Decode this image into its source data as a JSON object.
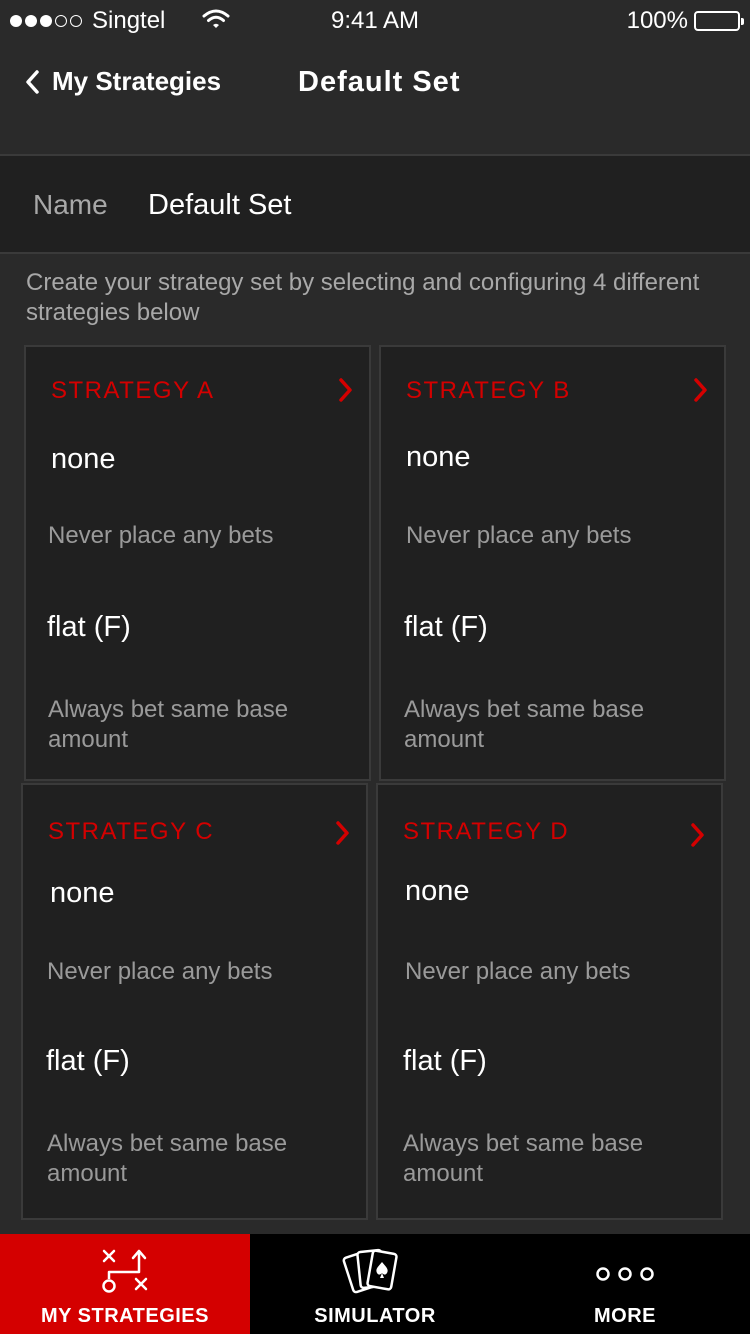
{
  "status_bar": {
    "carrier": "Singtel",
    "time": "9:41 AM",
    "battery": "100%",
    "signal_bars_filled": 3,
    "signal_bars_total": 5
  },
  "nav": {
    "back_label": "My Strategies",
    "title": "Default Set"
  },
  "name_row": {
    "label": "Name",
    "value": "Default Set"
  },
  "instructions": "Create your strategy set by selecting and configuring 4 different strategies below",
  "strategies": [
    {
      "title": "STRATEGY A",
      "bet_name": "none",
      "bet_desc": "Never place any bets",
      "sizing_name": "flat (F)",
      "sizing_desc": "Always bet same base amount"
    },
    {
      "title": "STRATEGY B",
      "bet_name": "none",
      "bet_desc": "Never place any bets",
      "sizing_name": "flat (F)",
      "sizing_desc": "Always bet same base amount"
    },
    {
      "title": "STRATEGY C",
      "bet_name": "none",
      "bet_desc": "Never place any bets",
      "sizing_name": "flat (F)",
      "sizing_desc": "Always bet same base amount"
    },
    {
      "title": "STRATEGY D",
      "bet_name": "none",
      "bet_desc": "Never place any bets",
      "sizing_name": "flat (F)",
      "sizing_desc": "Always bet same base amount"
    }
  ],
  "tabs": [
    {
      "label": "MY STRATEGIES",
      "icon": "strategy-play-icon",
      "active": true
    },
    {
      "label": "SIMULATOR",
      "icon": "playing-cards-icon",
      "active": false
    },
    {
      "label": "MORE",
      "icon": "more-dots-icon",
      "active": false
    }
  ],
  "colors": {
    "accent": "#d40000",
    "background": "#2a2a2a",
    "card_background": "#202020",
    "secondary_text": "#a8a8a8",
    "tab_bar": "#000000"
  }
}
